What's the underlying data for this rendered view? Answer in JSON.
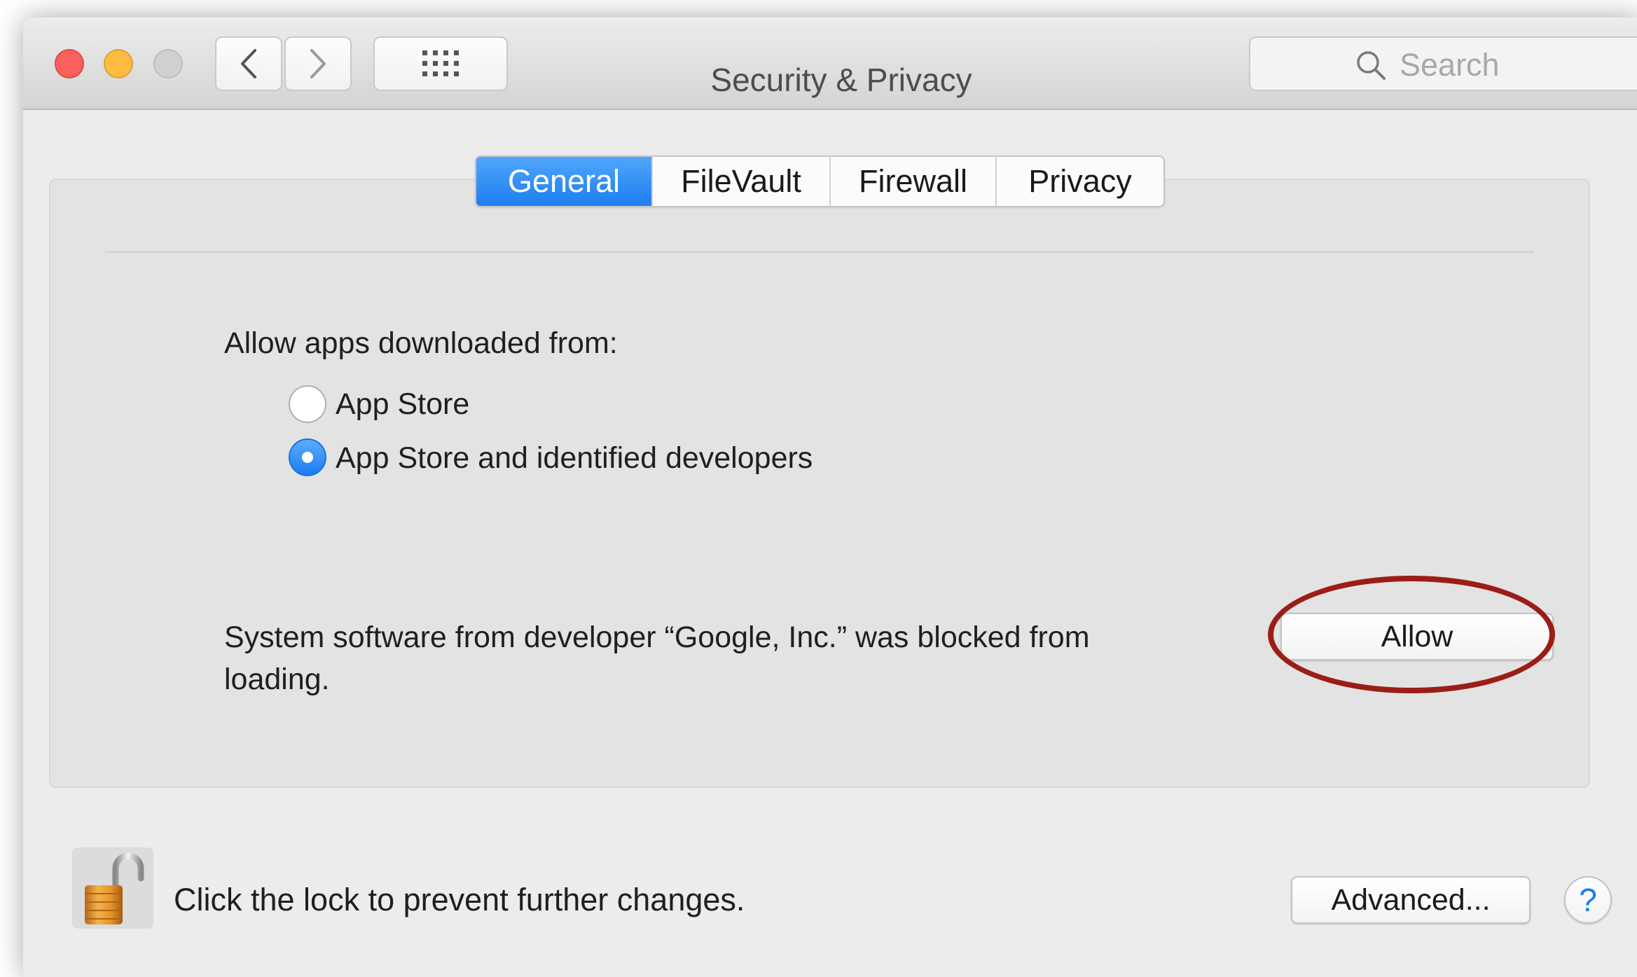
{
  "window": {
    "title": "Security & Privacy",
    "search_placeholder": "Search"
  },
  "tabs": [
    {
      "label": "General",
      "active": true
    },
    {
      "label": "FileVault",
      "active": false
    },
    {
      "label": "Firewall",
      "active": false
    },
    {
      "label": "Privacy",
      "active": false
    }
  ],
  "general": {
    "allow_heading": "Allow apps downloaded from:",
    "options": [
      {
        "label": "App Store",
        "selected": false
      },
      {
        "label": "App Store and identified developers",
        "selected": true
      }
    ],
    "blocked_message": "System software from developer “Google, Inc.” was blocked from loading.",
    "allow_button": "Allow"
  },
  "footer": {
    "lock_message": "Click the lock to prevent further changes.",
    "advanced_button": "Advanced...",
    "help_button": "?"
  },
  "colors": {
    "accent": "#1f7ef0",
    "highlight": "#9b1d18"
  },
  "icons": {
    "lock": "unlocked-padlock-icon",
    "search": "magnifier-icon",
    "back": "chevron-left-icon",
    "forward": "chevron-right-icon",
    "grid": "grid-dots-icon"
  }
}
